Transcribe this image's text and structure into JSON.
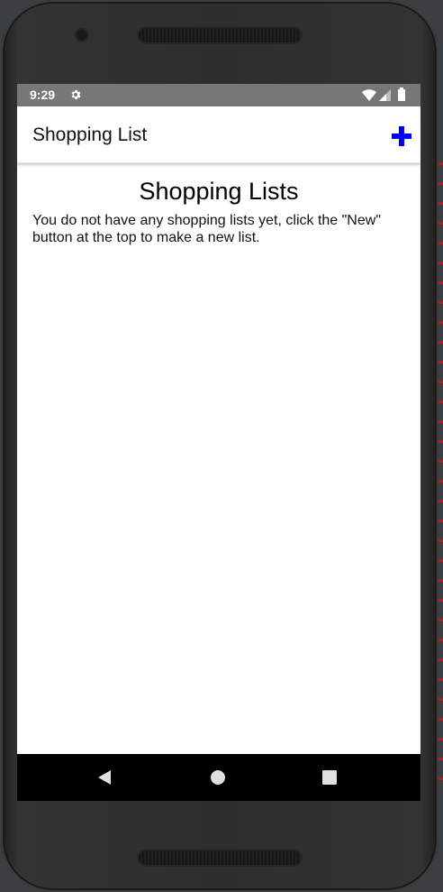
{
  "status_bar": {
    "time": "9:29",
    "icons": [
      "settings-icon",
      "wifi-icon",
      "cell-signal-icon",
      "battery-icon"
    ]
  },
  "app_bar": {
    "title": "Shopping List",
    "action_icon": "add-icon",
    "accent_color": "#0000ee"
  },
  "main": {
    "heading": "Shopping Lists",
    "empty_message": "You do not have any shopping lists yet, click the \"New\" button at the top to make a new list."
  },
  "navigation_bar": {
    "buttons": [
      "back-icon",
      "home-icon",
      "recents-icon"
    ]
  },
  "colors": {
    "status_bar_bg": "#777777",
    "nav_bar_bg": "#000000",
    "screen_bg": "#ffffff"
  }
}
